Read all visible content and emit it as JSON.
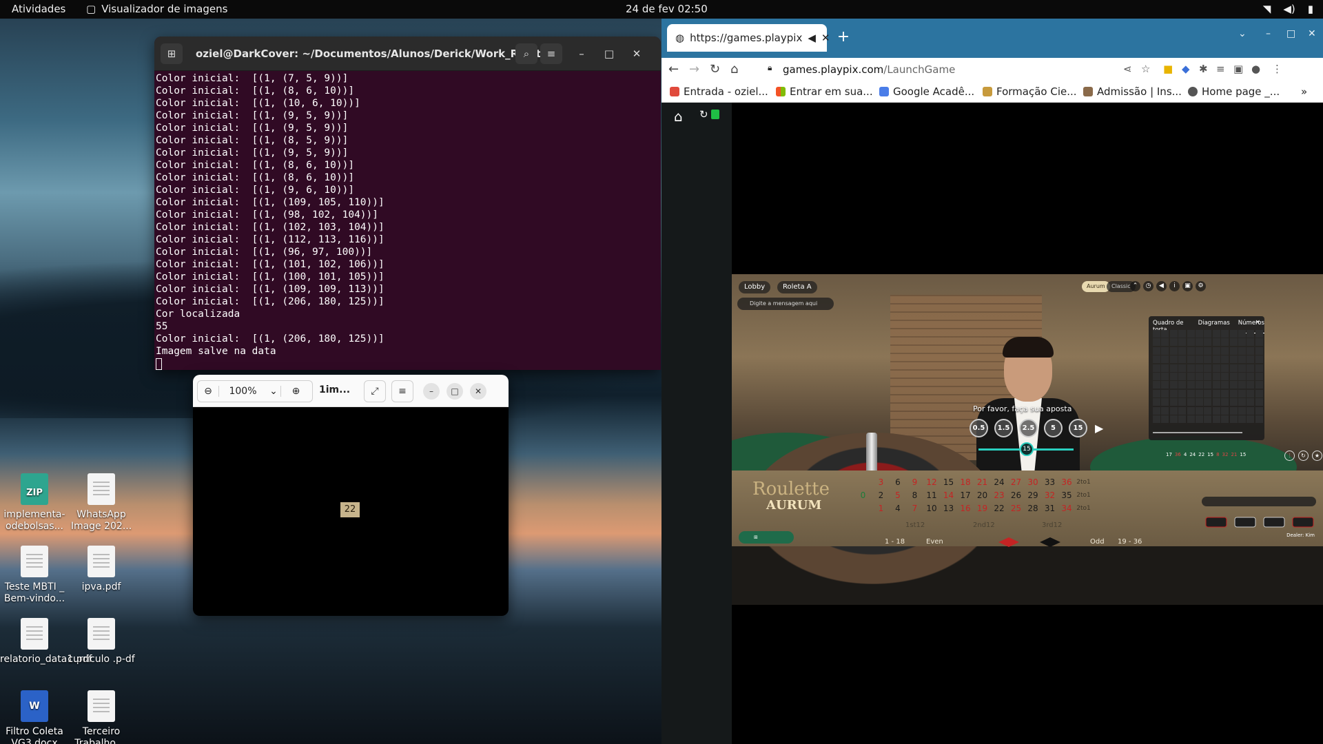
{
  "topbar": {
    "activities": "Atividades",
    "app_name": "Visualizador de imagens",
    "clock": "24 de fev  02:50"
  },
  "desktop_icons": [
    {
      "label": "implementa-odebolsas...",
      "type": "zip"
    },
    {
      "label": "WhatsApp Image 202...",
      "type": "doc"
    },
    {
      "label": "Teste MBTI _ Bem-vindo...",
      "type": "doc"
    },
    {
      "label": "ipva.pdf",
      "type": "doc"
    },
    {
      "label": "relatorio_data1.pdf",
      "type": "doc"
    },
    {
      "label": "curriculo .p-df",
      "type": "doc"
    },
    {
      "label": "Filtro Coleta VG3.docx",
      "type": "word"
    },
    {
      "label": "Terceiro Trabalho ...",
      "type": "doc"
    }
  ],
  "terminal": {
    "title": "oziel@DarkCover: ~/Documentos/Alunos/Derick/Work_Rolet...",
    "lines": [
      "Color inicial:  [(1, (7, 5, 9))]",
      "Color inicial:  [(1, (8, 6, 10))]",
      "Color inicial:  [(1, (10, 6, 10))]",
      "Color inicial:  [(1, (9, 5, 9))]",
      "Color inicial:  [(1, (9, 5, 9))]",
      "Color inicial:  [(1, (8, 5, 9))]",
      "Color inicial:  [(1, (9, 5, 9))]",
      "Color inicial:  [(1, (8, 6, 10))]",
      "Color inicial:  [(1, (8, 6, 10))]",
      "Color inicial:  [(1, (9, 6, 10))]",
      "Color inicial:  [(1, (109, 105, 110))]",
      "Color inicial:  [(1, (98, 102, 104))]",
      "Color inicial:  [(1, (102, 103, 104))]",
      "Color inicial:  [(1, (112, 113, 116))]",
      "Color inicial:  [(1, (96, 97, 100))]",
      "Color inicial:  [(1, (101, 102, 106))]",
      "Color inicial:  [(1, (100, 101, 105))]",
      "Color inicial:  [(1, (109, 109, 113))]",
      "Color inicial:  [(1, (206, 180, 125))]",
      "Cor localizada",
      "55",
      "Color inicial:  [(1, (206, 180, 125))]",
      "Imagem salve na data"
    ]
  },
  "viewer": {
    "zoom": "100%",
    "title": "1im...",
    "image_label": "22"
  },
  "browser": {
    "tab_title": "https://games.playpix",
    "url_host": "games.playpix.com",
    "url_path": "/LaunchGame",
    "bookmarks": [
      "Entrada - oziel...",
      "Entrar em sua...",
      "Google Acadê...",
      "Formação Cie...",
      "Admissão | Ins...",
      "Home page _..."
    ]
  },
  "game": {
    "lobby": "Lobby",
    "table_name": "Roleta A",
    "chat_placeholder": "Digite a mensagem aqui",
    "mode_aurum": "Aurum",
    "mode_classic": "Classic",
    "prompt": "Por favor, faça sua aposta",
    "chips": [
      "0.5",
      "1.5",
      "2.5",
      "5",
      "15"
    ],
    "timer": "15",
    "stats_tabs": [
      "Quadro de torta",
      "Diagramas",
      "Números"
    ],
    "stats_close": "×",
    "history": [
      "17",
      "36",
      "4",
      "24",
      "22",
      "15",
      "8",
      "32",
      "21",
      "15"
    ],
    "logo_line1": "Roulette",
    "logo_line2": "AURUM",
    "row_top": [
      "3",
      "6",
      "9",
      "12",
      "15",
      "18",
      "21",
      "24",
      "27",
      "30",
      "33",
      "36"
    ],
    "row_mid": [
      "2",
      "5",
      "8",
      "11",
      "14",
      "17",
      "20",
      "23",
      "26",
      "29",
      "32",
      "35"
    ],
    "row_bot": [
      "1",
      "4",
      "7",
      "10",
      "13",
      "16",
      "19",
      "22",
      "25",
      "28",
      "31",
      "34"
    ],
    "zero": "0",
    "col_label": "2to1",
    "dozens": [
      "1st12",
      "2nd12",
      "3rd12"
    ],
    "outside": [
      "1 - 18",
      "Even",
      "Odd",
      "19 - 36"
    ],
    "dealer": "Dealer: Kim"
  },
  "colors": {
    "terminal_bg": "#300a24",
    "browser_tabstrip": "#2c74a0",
    "timer_accent": "#2ad0c0"
  }
}
